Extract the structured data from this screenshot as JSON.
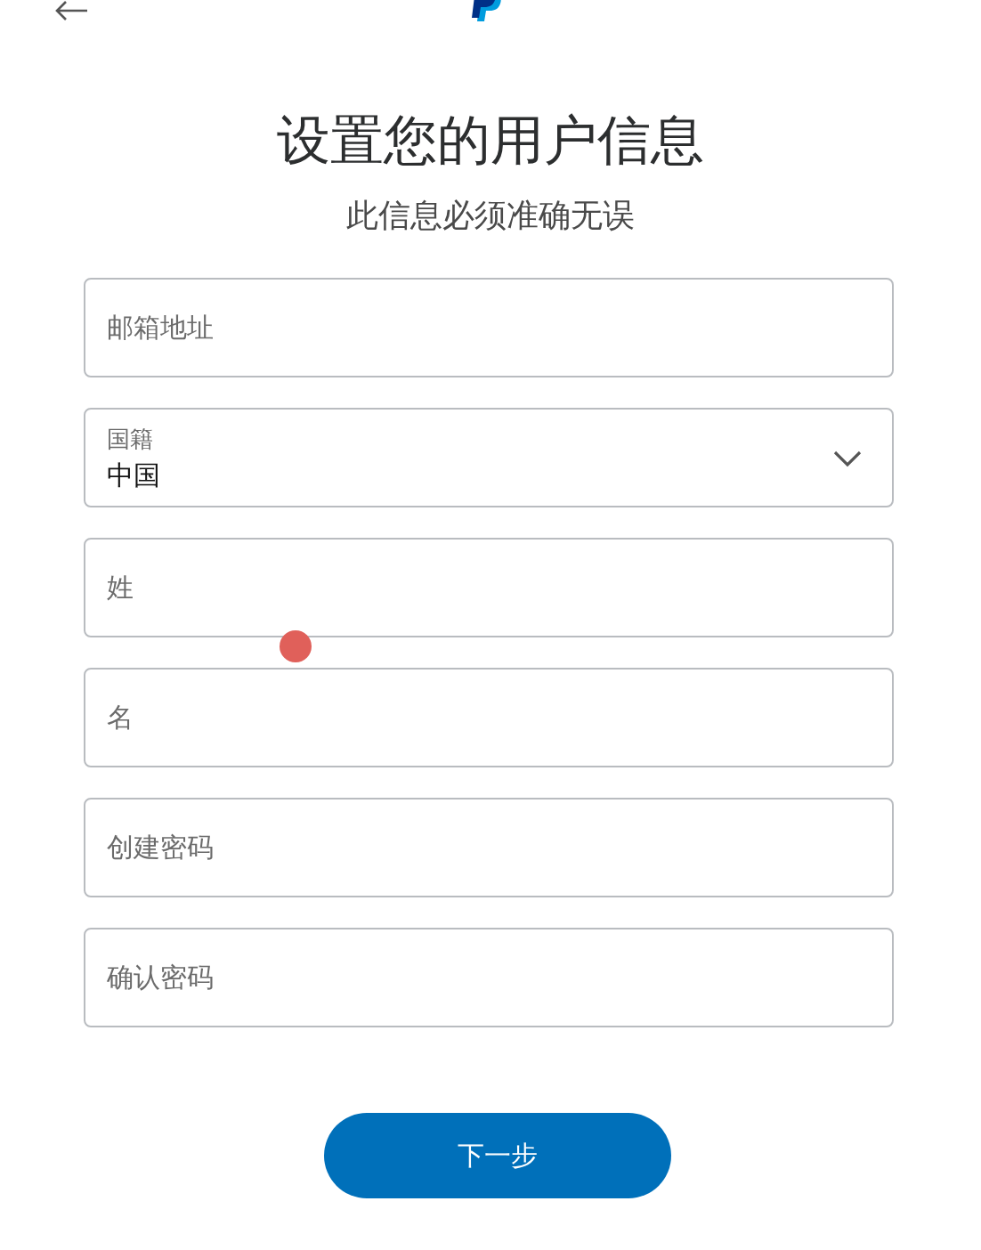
{
  "header": {
    "title": "设置您的用户信息",
    "subtitle": "此信息必须准确无误"
  },
  "fields": [
    {
      "kind": "text",
      "placeholder": "邮箱地址"
    },
    {
      "kind": "select",
      "label": "国籍",
      "value": "中国"
    },
    {
      "kind": "text",
      "placeholder": "姓"
    },
    {
      "kind": "text",
      "placeholder": "名"
    },
    {
      "kind": "password",
      "placeholder": "创建密码"
    },
    {
      "kind": "password",
      "placeholder": "确认密码"
    }
  ],
  "next_button": "下一步"
}
